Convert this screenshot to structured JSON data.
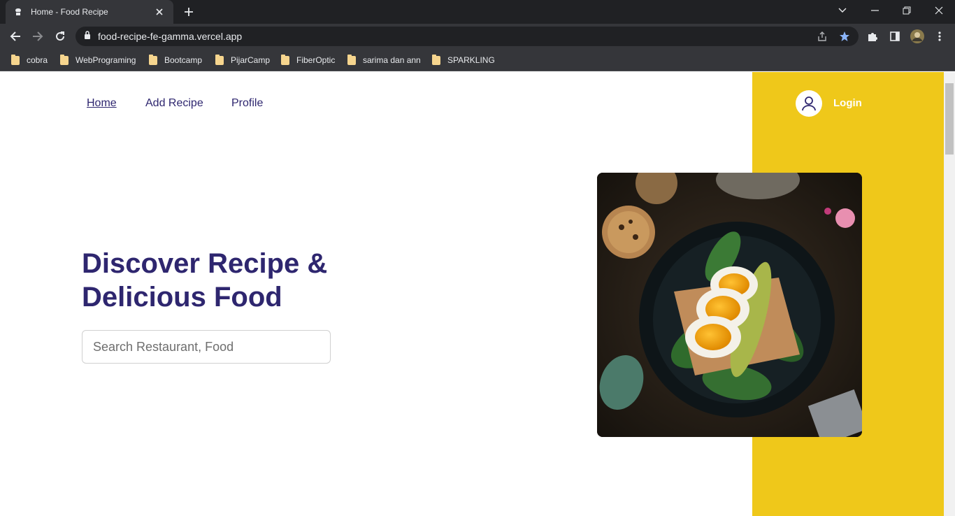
{
  "browser": {
    "tab_title": "Home - Food Recipe",
    "url": "food-recipe-fe-gamma.vercel.app",
    "bookmarks": [
      "cobra",
      "WebPrograming",
      "Bootcamp",
      "PijarCamp",
      "FiberOptic",
      "sarima dan ann",
      "SPARKLING"
    ]
  },
  "nav": {
    "home": "Home",
    "add_recipe": "Add Recipe",
    "profile": "Profile",
    "login": "Login"
  },
  "hero": {
    "title": "Discover Recipe & Delicious Food",
    "search_placeholder": "Search Restaurant, Food"
  },
  "colors": {
    "accent_yellow": "#efc81a",
    "brand_navy": "#2e266f"
  }
}
